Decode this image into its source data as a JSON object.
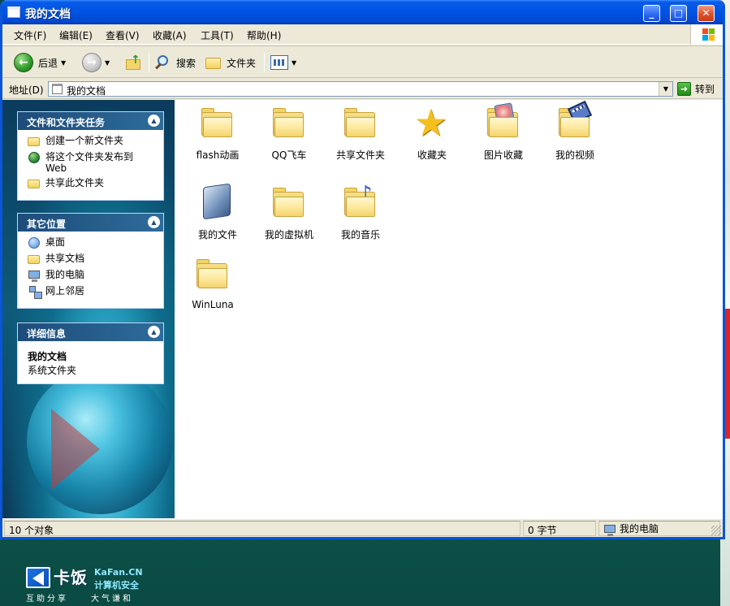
{
  "window": {
    "title": "我的文档"
  },
  "menu": [
    "文件(F)",
    "编辑(E)",
    "查看(V)",
    "收藏(A)",
    "工具(T)",
    "帮助(H)"
  ],
  "toolbar": {
    "back": "后退",
    "search": "搜索",
    "folders": "文件夹"
  },
  "address": {
    "label": "地址(D)",
    "value": "我的文档",
    "go": "转到"
  },
  "sidebar": {
    "tasks": {
      "title": "文件和文件夹任务",
      "items": [
        "创建一个新文件夹",
        "将这个文件夹发布到 Web",
        "共享此文件夹"
      ]
    },
    "places": {
      "title": "其它位置",
      "items": [
        "桌面",
        "共享文档",
        "我的电脑",
        "网上邻居"
      ]
    },
    "details": {
      "title": "详细信息",
      "name": "我的文档",
      "desc": "系统文件夹"
    }
  },
  "items": [
    {
      "label": "flash动画",
      "icon": "folder-icon",
      "selected": true
    },
    {
      "label": "QQ飞车",
      "icon": "folder-icon"
    },
    {
      "label": "共享文件夹",
      "icon": "folder-icon"
    },
    {
      "label": "收藏夹",
      "icon": "star-icon"
    },
    {
      "label": "图片收藏",
      "icon": "pictures-folder-icon"
    },
    {
      "label": "我的视频",
      "icon": "videos-folder-icon"
    },
    {
      "label": "我的文件",
      "icon": "documents-icon"
    },
    {
      "label": "我的虚拟机",
      "icon": "folder-icon"
    },
    {
      "label": "我的音乐",
      "icon": "music-folder-icon"
    },
    {
      "label": "WinLuna",
      "icon": "folder-icon"
    }
  ],
  "status": {
    "count": "10 个对象",
    "size": "0 字节",
    "location": "我的电脑"
  },
  "brand": {
    "name": "卡饭",
    "site": "KaFan.CN",
    "site_sub": "计算机安全",
    "tagline1": "互助分享",
    "tagline2": "大气谦和"
  }
}
